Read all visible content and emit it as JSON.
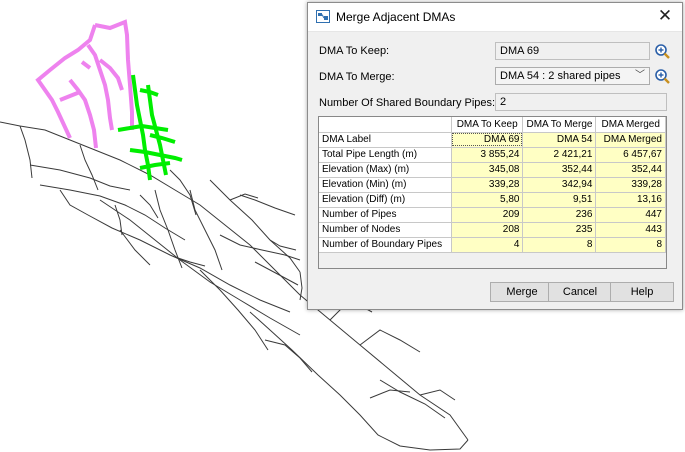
{
  "dialog": {
    "title": "Merge Adjacent DMAs",
    "dma_to_keep_label": "DMA To Keep:",
    "dma_to_keep_value": "DMA 69",
    "dma_to_merge_label": "DMA To Merge:",
    "dma_to_merge_value": "DMA 54 : 2 shared pipes",
    "shared_pipes_label": "Number Of Shared Boundary Pipes:",
    "shared_pipes_value": "2",
    "buttons": {
      "merge": "Merge",
      "cancel": "Cancel",
      "help": "Help"
    }
  },
  "table": {
    "columns": [
      "DMA To Keep",
      "DMA To Merge",
      "DMA Merged"
    ],
    "rows": [
      {
        "label": "DMA Label",
        "keep": "DMA 69",
        "merge": "DMA 54",
        "merged": "DMA Merged"
      },
      {
        "label": "Total Pipe Length (m)",
        "keep": "3 855,24",
        "merge": "2 421,21",
        "merged": "6 457,67"
      },
      {
        "label": "Elevation (Max) (m)",
        "keep": "345,08",
        "merge": "352,44",
        "merged": "352,44"
      },
      {
        "label": "Elevation (Min) (m)",
        "keep": "339,28",
        "merge": "342,94",
        "merged": "339,28"
      },
      {
        "label": "Elevation (Diff) (m)",
        "keep": "5,80",
        "merge": "9,51",
        "merged": "13,16"
      },
      {
        "label": "Number of Pipes",
        "keep": "209",
        "merge": "236",
        "merged": "447"
      },
      {
        "label": "Number of Nodes",
        "keep": "208",
        "merge": "235",
        "merged": "443"
      },
      {
        "label": "Number of Boundary Pipes",
        "keep": "4",
        "merge": "8",
        "merged": "8"
      }
    ]
  },
  "colors": {
    "dma_keep_highlight": "#ee82ee",
    "dma_merge_highlight": "#00ee00",
    "network_lines": "#333333",
    "grid_value_bg": "#ffffc4"
  }
}
